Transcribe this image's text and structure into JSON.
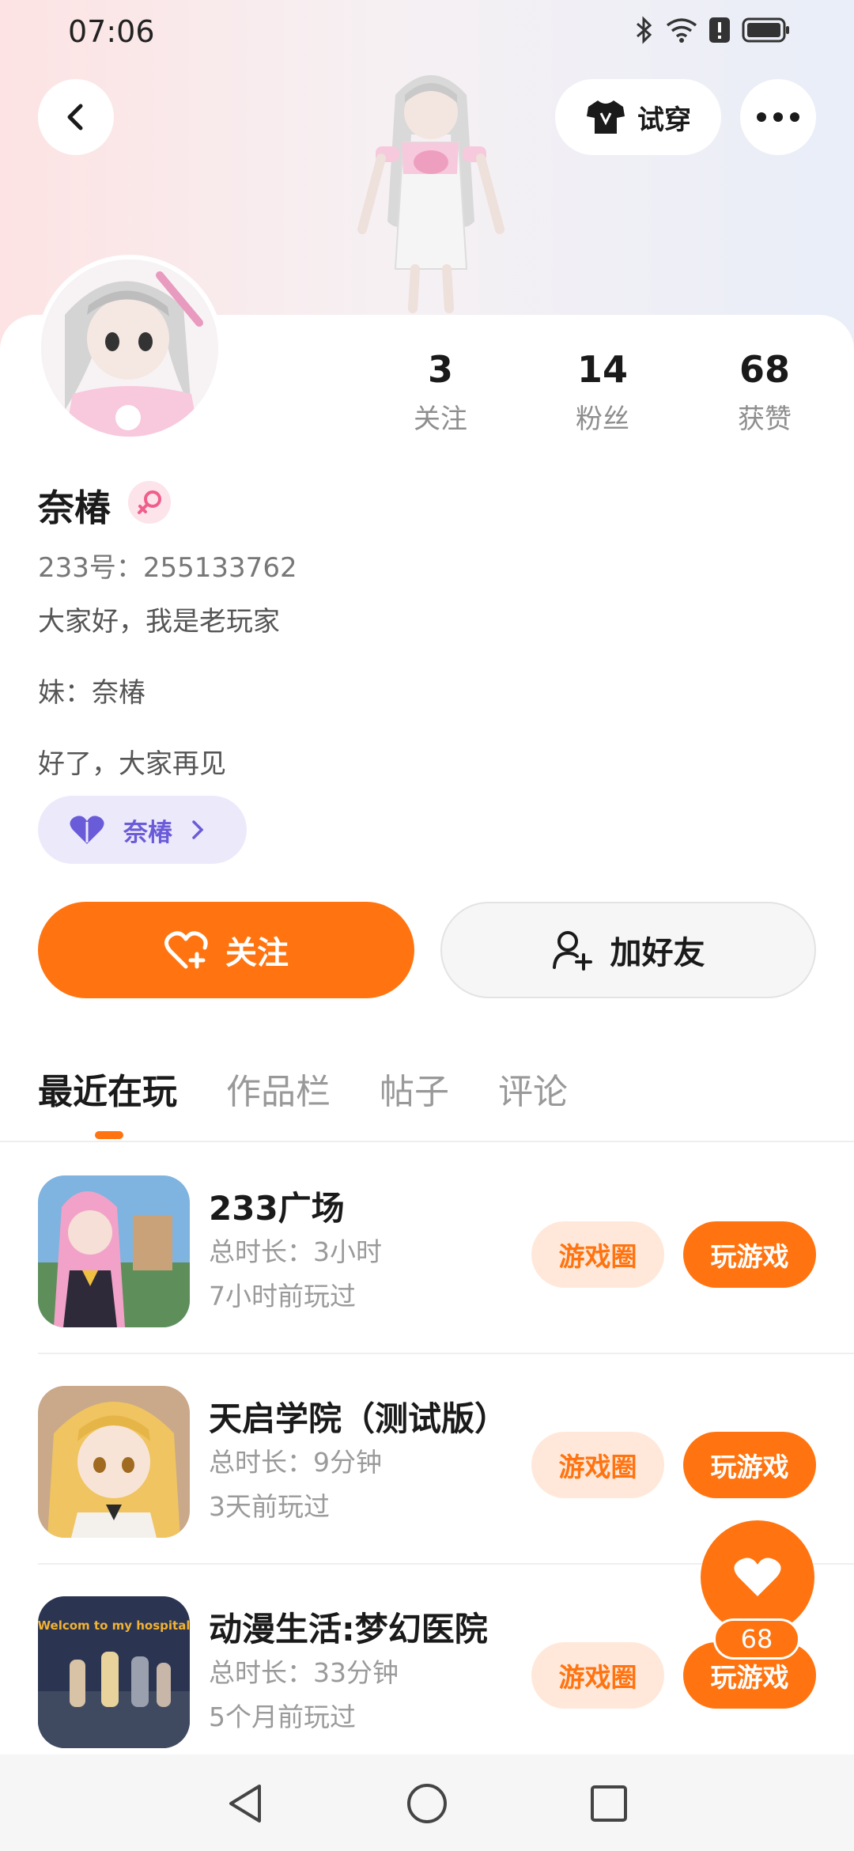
{
  "status_bar": {
    "time": "07:06",
    "icons": [
      "bluetooth-icon",
      "wifi-icon",
      "alert-icon",
      "battery-icon"
    ]
  },
  "header": {
    "try_on_label": "试穿"
  },
  "stats": [
    {
      "value": "3",
      "label": "关注"
    },
    {
      "value": "14",
      "label": "粉丝"
    },
    {
      "value": "68",
      "label": "获赞"
    }
  ],
  "profile": {
    "name": "奈椿",
    "id_line": "233号：255133762",
    "bio": [
      "大家好，我是老玩家",
      "妹：奈椿",
      "好了，大家再见"
    ],
    "tag_label": "奈椿"
  },
  "actions": {
    "follow_label": "关注",
    "add_friend_label": "加好友"
  },
  "tabs": [
    "最近在玩",
    "作品栏",
    "帖子",
    "评论"
  ],
  "games": [
    {
      "title": "233广场",
      "duration": "总时长：3小时",
      "last_played": "7小时前玩过",
      "circle_label": "游戏圈",
      "play_label": "玩游戏"
    },
    {
      "title": "天启学院（测试版）",
      "duration": "总时长：9分钟",
      "last_played": "3天前玩过",
      "circle_label": "游戏圈",
      "play_label": "玩游戏"
    },
    {
      "title": "动漫生活:梦幻医院",
      "duration": "总时长：33分钟",
      "last_played": "5个月前玩过",
      "circle_label": "游戏圈",
      "play_label": "玩游戏",
      "thumb_text": "Welcom to my hospital"
    }
  ],
  "like_fab": {
    "count": "68"
  },
  "colors": {
    "accent": "#ff7410",
    "accent_light": "#ffe8da",
    "tag_bg": "#ece9fb",
    "tag_text": "#6a5bd8"
  }
}
